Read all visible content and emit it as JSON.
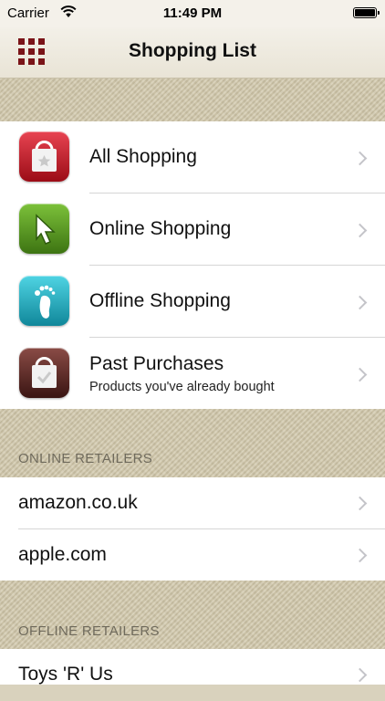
{
  "status_bar": {
    "carrier": "Carrier",
    "time": "11:49 PM"
  },
  "nav": {
    "title": "Shopping List",
    "menu_icon": "grid-icon"
  },
  "menu": {
    "items": [
      {
        "label": "All Shopping",
        "icon": "shopping-bag-star-icon",
        "color": "#b3121e"
      },
      {
        "label": "Online Shopping",
        "icon": "cursor-arrow-icon",
        "color": "#4e8a1c"
      },
      {
        "label": "Offline Shopping",
        "icon": "footprint-icon",
        "color": "#1aa4b5"
      },
      {
        "label": "Past Purchases",
        "subtitle": "Products you've already bought",
        "icon": "shopping-bag-check-icon",
        "color": "#5b2a26"
      }
    ]
  },
  "online_retailers": {
    "header": "ONLINE RETAILERS",
    "items": [
      {
        "label": "amazon.co.uk"
      },
      {
        "label": "apple.com"
      }
    ]
  },
  "offline_retailers": {
    "header": "OFFLINE RETAILERS",
    "items": [
      {
        "label": "Toys 'R' Us"
      }
    ]
  }
}
